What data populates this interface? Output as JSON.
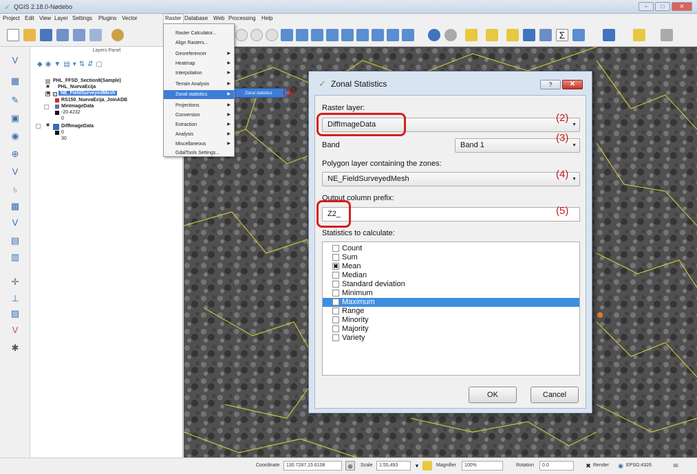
{
  "window": {
    "title": "QGIS 2.18.0-Nødebo",
    "min": "–",
    "max": "□",
    "close": "✕"
  },
  "menubar": [
    "Project",
    "Edit",
    "View",
    "Layer",
    "Settings",
    "Plugins",
    "Vector",
    "Raster",
    "Database",
    "Web",
    "Processing",
    "Help"
  ],
  "layers_panel": {
    "title": "Layers Panel",
    "rows": [
      {
        "label": "PHL_FFSD_Section8(Sample)",
        "bold": true
      },
      {
        "label": "PHL_NuevaEcija",
        "bold": true
      },
      {
        "label": "NE_FieldSurveyedMesh",
        "bold": true,
        "selected": true
      },
      {
        "label": "RS150_NuevaEcija_JoinADB",
        "bold": true
      },
      {
        "label": "MinImageData",
        "bold": true
      },
      {
        "label": "-20.4232",
        "bold": false
      },
      {
        "label": "0",
        "bold": false
      },
      {
        "label": "DiffImageData",
        "bold": true
      },
      {
        "label": "0",
        "bold": false
      },
      {
        "label": "30",
        "bold": false
      }
    ]
  },
  "raster_menu": {
    "items": [
      {
        "label": "Raster Calculator...",
        "arrow": false
      },
      {
        "label": "Align Rasters...",
        "arrow": false
      },
      {
        "label": "Georeferencer",
        "arrow": true
      },
      {
        "label": "Heatmap",
        "arrow": true
      },
      {
        "label": "Interpolation",
        "arrow": true
      },
      {
        "label": "Terrain Analysis",
        "arrow": true
      },
      {
        "label": "Zonal statistics",
        "arrow": true,
        "highlight": true
      },
      {
        "label": "Projections",
        "arrow": true
      },
      {
        "label": "Conversion",
        "arrow": true
      },
      {
        "label": "Extraction",
        "arrow": true
      },
      {
        "label": "Analysis",
        "arrow": true
      },
      {
        "label": "Miscellaneous",
        "arrow": true
      },
      {
        "label": "GdalTools Settings...",
        "arrow": false
      }
    ],
    "submenu_item": "Zonal statistics"
  },
  "annotations": [
    "(1)",
    "(2)",
    "(3)",
    "(4)",
    "(5)"
  ],
  "dialog": {
    "title": "Zonal Statistics",
    "help": "?",
    "close": "✕",
    "raster_layer_label": "Raster layer:",
    "raster_layer_value": "DiffImageData",
    "band_label": "Band",
    "band_value": "Band 1",
    "polygon_label": "Polygon layer containing the zones:",
    "polygon_value": "NE_FieldSurveyedMesh",
    "prefix_label": "Output column prefix:",
    "prefix_value": "Z2_",
    "stats_label": "Statistics to calculate:",
    "stats": [
      {
        "label": "Count",
        "checked": false
      },
      {
        "label": "Sum",
        "checked": false
      },
      {
        "label": "Mean",
        "checked": true
      },
      {
        "label": "Median",
        "checked": false
      },
      {
        "label": "Standard deviation",
        "checked": false
      },
      {
        "label": "Minimum",
        "checked": false
      },
      {
        "label": "Maximum",
        "checked": false,
        "highlight": true
      },
      {
        "label": "Range",
        "checked": false
      },
      {
        "label": "Minority",
        "checked": false
      },
      {
        "label": "Majority",
        "checked": false
      },
      {
        "label": "Variety",
        "checked": false
      }
    ],
    "ok": "OK",
    "cancel": "Cancel"
  },
  "statusbar": {
    "coordinate_label": "Coordinate",
    "coordinate_value": "130.7287,15.6108",
    "scale_label": "Scale",
    "scale_value": "1:55,493",
    "magnifier_label": "Magnifier",
    "magnifier_value": "100%",
    "rotation_label": "Rotation",
    "rotation_value": "0.0",
    "render_label": "Render",
    "crs_label": "EPSG:4326"
  }
}
